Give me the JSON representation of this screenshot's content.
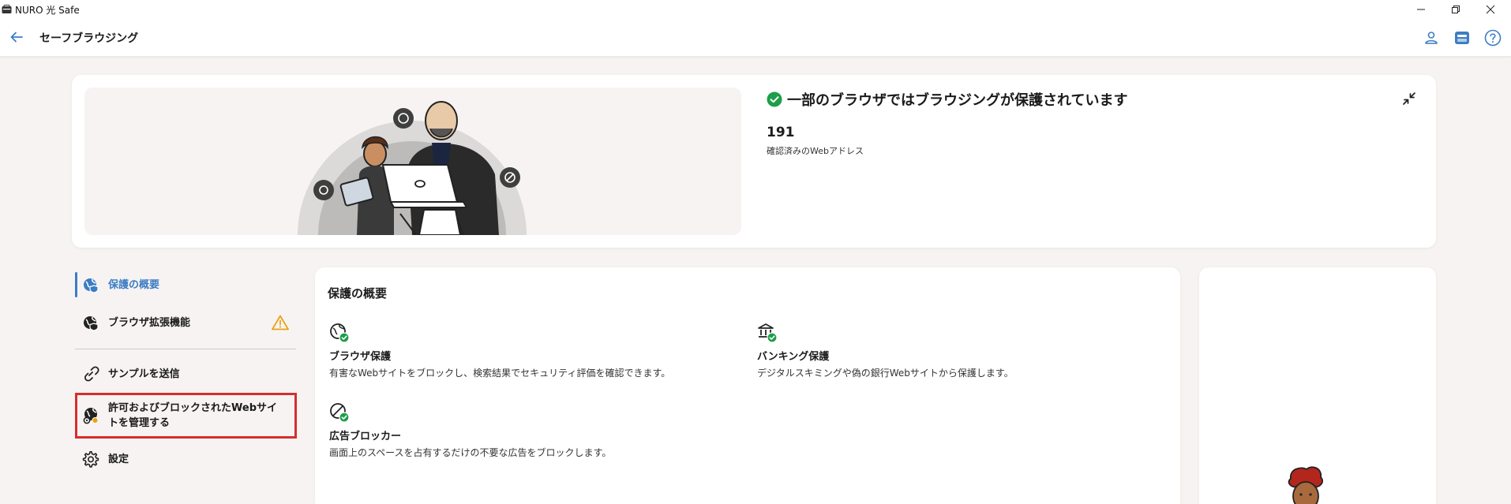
{
  "window": {
    "title": "NURO 光 Safe"
  },
  "header": {
    "title": "セーフブラウジング"
  },
  "hero": {
    "status_text": "一部のブラウザではブラウジングが保護されています",
    "stat_value": "191",
    "stat_label": "確認済みのWebアドレス"
  },
  "sidebar": {
    "items": [
      {
        "label": "保護の概要",
        "icon": "globe-shield-icon",
        "active": true
      },
      {
        "label": "ブラウザ拡張機能",
        "icon": "globe-shield-icon",
        "warning": true
      },
      {
        "label": "サンプルを送信",
        "icon": "link-upload-icon"
      },
      {
        "label": "許可およびブロックされたWebサイトを管理する",
        "icon": "globe-settings-icon"
      },
      {
        "label": "設定",
        "icon": "gear-icon"
      }
    ]
  },
  "main": {
    "title": "保護の概要",
    "features": [
      {
        "name": "ブラウザ保護",
        "desc": "有害なWebサイトをブロックし、検索結果でセキュリティ評価を確認できます。",
        "icon": "globe-check-icon"
      },
      {
        "name": "バンキング保護",
        "desc": "デジタルスキミングや偽の銀行Webサイトから保護します。",
        "icon": "bank-check-icon"
      },
      {
        "name": "広告ブロッカー",
        "desc": "画面上のスペースを占有するだけの不要な広告をブロックします。",
        "icon": "block-check-icon"
      }
    ]
  },
  "colors": {
    "accent": "#3c7dc4",
    "success": "#1e9e4a",
    "warning": "#e8a317",
    "highlight": "#d32f2f",
    "background": "#f7f3f2"
  }
}
